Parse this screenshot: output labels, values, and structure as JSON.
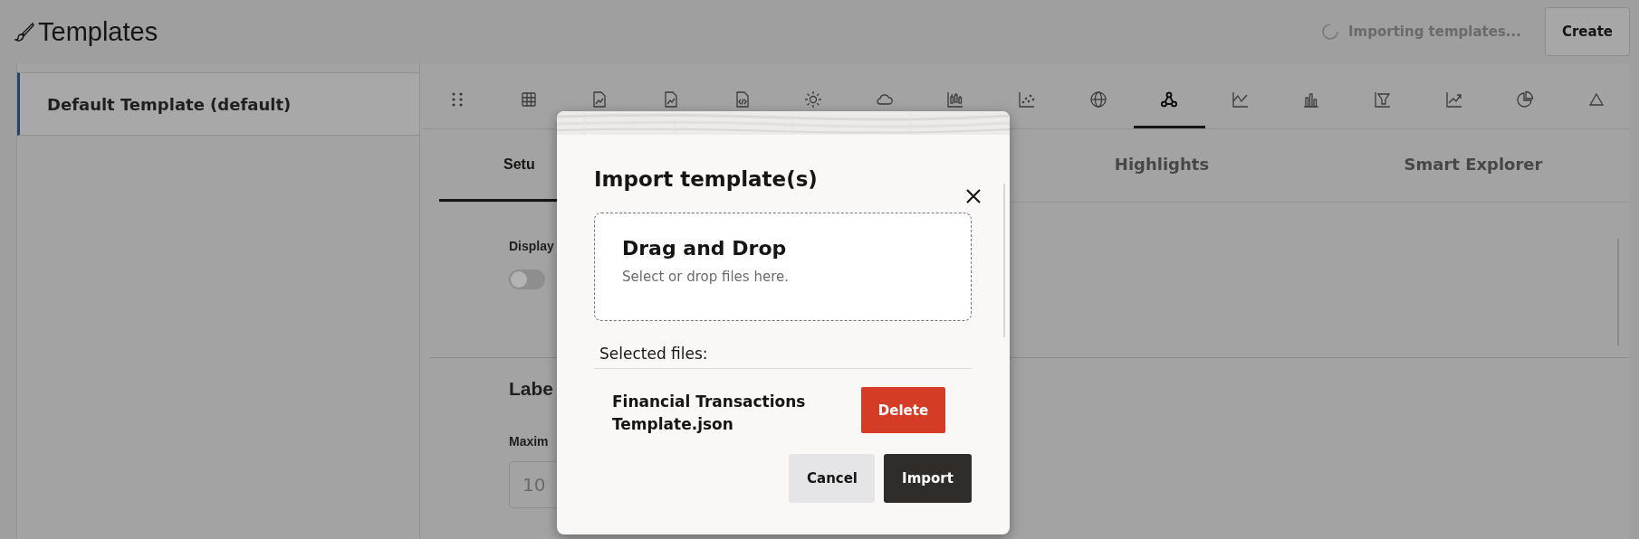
{
  "header": {
    "title": "Templates",
    "status": "Importing templates...",
    "create_button": "Create"
  },
  "sidebar": {
    "items": [
      {
        "label": "Default Template (default)",
        "selected": true
      }
    ]
  },
  "toolbar": {
    "icons": [
      {
        "selected": false
      },
      {
        "selected": false
      },
      {
        "selected": false
      },
      {
        "selected": false
      },
      {
        "selected": false
      },
      {
        "selected": false
      },
      {
        "selected": false
      },
      {
        "selected": false
      },
      {
        "selected": false
      },
      {
        "selected": false
      },
      {
        "selected": true
      },
      {
        "selected": false
      },
      {
        "selected": false
      },
      {
        "selected": false
      },
      {
        "selected": false
      },
      {
        "selected": false
      },
      {
        "selected": false
      }
    ]
  },
  "tabs": [
    {
      "label": "Setu",
      "selected": true
    },
    {
      "label": "Highlights",
      "selected": false
    },
    {
      "label": "Smart Explorer",
      "selected": false
    }
  ],
  "settings": {
    "display_label": "Display",
    "display_toggle": {
      "on": false
    },
    "label_heading": "Labe",
    "max_label": "Maxim",
    "max_value": "10"
  },
  "dialog": {
    "title": "Import template(s)",
    "dropzone": {
      "heading": "Drag and Drop",
      "hint": "Select or drop files here."
    },
    "selected_label": "Selected files:",
    "files": [
      {
        "name": "Financial Transactions Template.json",
        "delete": "Delete"
      }
    ],
    "cancel": "Cancel",
    "import": "Import"
  }
}
